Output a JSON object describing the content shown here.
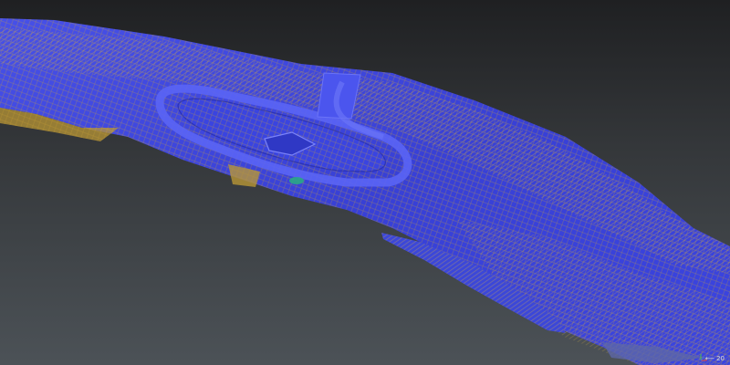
{
  "viewport": {
    "scale_bar_label": "20",
    "scale_bar_arrows": "⟵",
    "mesh_color": "#3a44e0",
    "mesh_highlight": "#5560f2",
    "mesh_wire_color": "#c9a233",
    "background_top": "#1f2022",
    "background_bottom": "#4c5257"
  },
  "icons": {
    "axis_gizmo": "axis-gizmo-icon"
  }
}
